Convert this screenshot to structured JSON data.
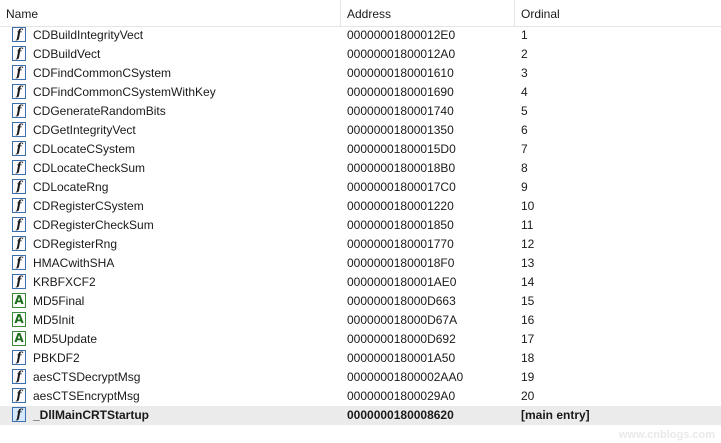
{
  "header": {
    "name_label": "Name",
    "address_label": "Address",
    "ordinal_label": "Ordinal"
  },
  "icons": {
    "function": "f",
    "data": "A"
  },
  "rows": [
    {
      "name": "CDBuildIntegrityVect",
      "address": "00000001800012E0",
      "ordinal": "1",
      "icon": "function"
    },
    {
      "name": "CDBuildVect",
      "address": "00000001800012A0",
      "ordinal": "2",
      "icon": "function"
    },
    {
      "name": "CDFindCommonCSystem",
      "address": "0000000180001610",
      "ordinal": "3",
      "icon": "function"
    },
    {
      "name": "CDFindCommonCSystemWithKey",
      "address": "0000000180001690",
      "ordinal": "4",
      "icon": "function"
    },
    {
      "name": "CDGenerateRandomBits",
      "address": "0000000180001740",
      "ordinal": "5",
      "icon": "function"
    },
    {
      "name": "CDGetIntegrityVect",
      "address": "0000000180001350",
      "ordinal": "6",
      "icon": "function"
    },
    {
      "name": "CDLocateCSystem",
      "address": "00000001800015D0",
      "ordinal": "7",
      "icon": "function"
    },
    {
      "name": "CDLocateCheckSum",
      "address": "00000001800018B0",
      "ordinal": "8",
      "icon": "function"
    },
    {
      "name": "CDLocateRng",
      "address": "00000001800017C0",
      "ordinal": "9",
      "icon": "function"
    },
    {
      "name": "CDRegisterCSystem",
      "address": "0000000180001220",
      "ordinal": "10",
      "icon": "function"
    },
    {
      "name": "CDRegisterCheckSum",
      "address": "0000000180001850",
      "ordinal": "11",
      "icon": "function"
    },
    {
      "name": "CDRegisterRng",
      "address": "0000000180001770",
      "ordinal": "12",
      "icon": "function"
    },
    {
      "name": "HMACwithSHA",
      "address": "00000001800018F0",
      "ordinal": "13",
      "icon": "function"
    },
    {
      "name": "KRBFXCF2",
      "address": "0000000180001AE0",
      "ordinal": "14",
      "icon": "function"
    },
    {
      "name": "MD5Final",
      "address": "000000018000D663",
      "ordinal": "15",
      "icon": "data"
    },
    {
      "name": "MD5Init",
      "address": "000000018000D67A",
      "ordinal": "16",
      "icon": "data"
    },
    {
      "name": "MD5Update",
      "address": "000000018000D692",
      "ordinal": "17",
      "icon": "data"
    },
    {
      "name": "PBKDF2",
      "address": "0000000180001A50",
      "ordinal": "18",
      "icon": "function"
    },
    {
      "name": "aesCTSDecryptMsg",
      "address": "00000001800002AA0",
      "ordinal": "19",
      "icon": "function"
    },
    {
      "name": "aesCTSEncryptMsg",
      "address": "00000001800029A0",
      "ordinal": "20",
      "icon": "function"
    },
    {
      "name": "_DllMainCRTStartup",
      "address": "0000000180008620",
      "ordinal": "[main entry]",
      "icon": "function",
      "selected": true
    }
  ],
  "watermark": "www.cnblogs.com"
}
